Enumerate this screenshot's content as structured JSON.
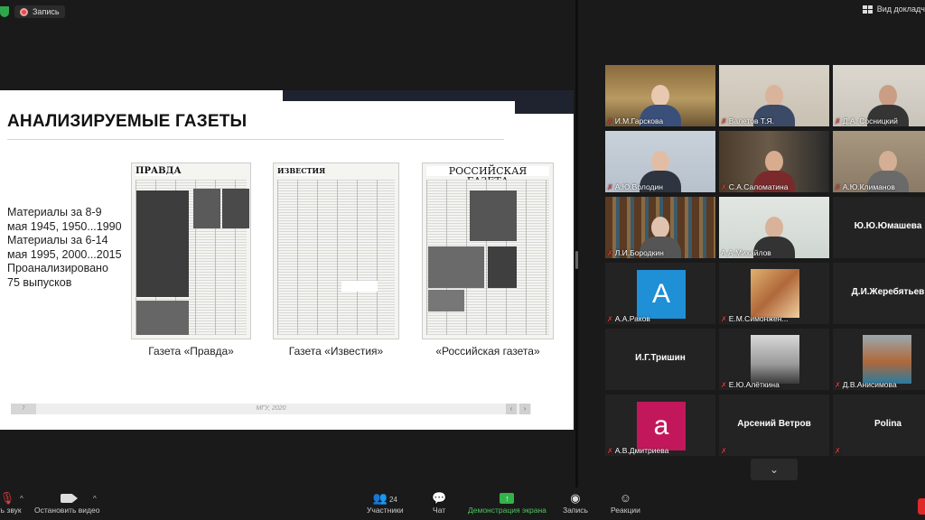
{
  "topbar": {
    "recording_label": "Запись",
    "view_label": "Вид докладч"
  },
  "slide": {
    "title": "АНАЛИЗИРУЕМЫЕ ГАЗЕТЫ",
    "body_lines": [
      "Материалы за 8-9 мая 1945, 1950...1990",
      "Материалы за 6-14 мая 1995, 2000...2015",
      "Проанализировано 75 выпусков"
    ],
    "newspapers": [
      {
        "masthead": "ПРАВДА",
        "caption": "Газета «Правда»"
      },
      {
        "masthead": "ИЗВЕСТИЯ",
        "caption": "Газета «Известия»"
      },
      {
        "masthead": "РОССИЙСКАЯ ГАЗЕТА",
        "caption": "«Российская газета»"
      }
    ],
    "footer_page": "7",
    "footer_text": "МГУ, 2020",
    "nav_prev": "‹",
    "nav_next": "›"
  },
  "participants": [
    {
      "name": "И.М.Гарскова",
      "muted": true,
      "type": "video"
    },
    {
      "name": "Валетов Т.Я.",
      "muted": true,
      "type": "video"
    },
    {
      "name": "Д.А. Сосницкий",
      "muted": true,
      "type": "video"
    },
    {
      "name": "А.Ю.Володин",
      "muted": true,
      "type": "video"
    },
    {
      "name": "С.А.Саломатина",
      "muted": true,
      "type": "video"
    },
    {
      "name": "А.Ю.Климанов",
      "muted": true,
      "type": "video"
    },
    {
      "name": "Л.И.Бородкин",
      "muted": true,
      "type": "video"
    },
    {
      "name": "А.А.Михайлов",
      "muted": false,
      "type": "video",
      "active": true
    },
    {
      "name": "Ю.Ю.Юмашева",
      "muted": false,
      "type": "text"
    },
    {
      "name": "А.А.Раков",
      "muted": true,
      "type": "avatar",
      "letter": "A",
      "color": "#1f8fd6"
    },
    {
      "name": "Е.М.Симонжен...",
      "muted": true,
      "type": "photo"
    },
    {
      "name": "Д.И.Жеребятьев",
      "muted": false,
      "type": "text"
    },
    {
      "name": "И.Г.Тришин",
      "muted": false,
      "type": "text"
    },
    {
      "name": "Е.Ю.Алёткина",
      "muted": true,
      "type": "photo"
    },
    {
      "name": "Д.В.Анисимова",
      "muted": true,
      "type": "photo"
    },
    {
      "name": "А.В.Дмитриева",
      "muted": true,
      "type": "avatar",
      "letter": "a",
      "color": "#c2185b"
    },
    {
      "name": "Арсений Ветров",
      "muted": true,
      "type": "text"
    },
    {
      "name": "Polina",
      "muted": true,
      "type": "text"
    }
  ],
  "toolbar": {
    "audio_label": "ить звук",
    "video_label": "Остановить видео",
    "participants_label": "Участники",
    "participants_count": "24",
    "chat_label": "Чат",
    "share_label": "Демонстрация экрана",
    "record_label": "Запись",
    "reactions_label": "Реакции"
  },
  "colors": {
    "accent_green": "#32b34a",
    "active_speaker": "#c9d94a",
    "muted_red": "#e23b3b"
  }
}
